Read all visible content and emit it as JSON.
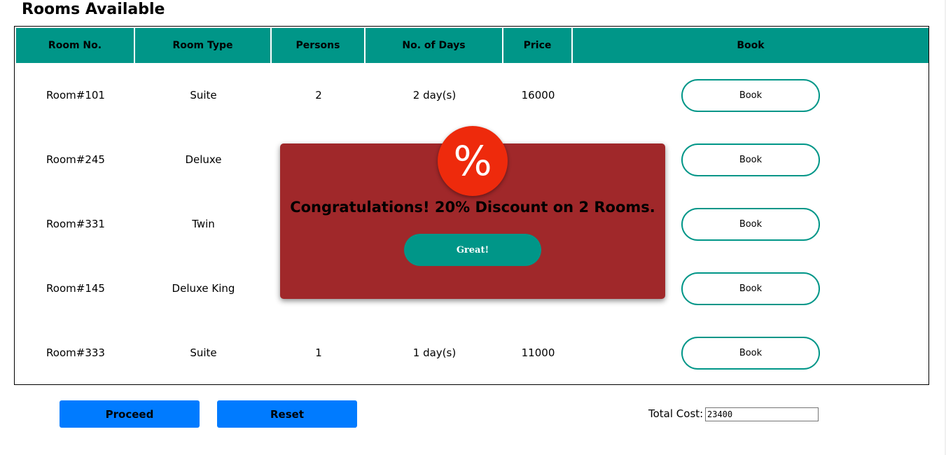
{
  "page": {
    "title": "Rooms Available"
  },
  "table": {
    "headers": [
      "Room No.",
      "Room Type",
      "Persons",
      "No. of Days",
      "Price",
      "Book"
    ],
    "rows": [
      {
        "room_no": "Room#101",
        "room_type": "Suite",
        "persons": "2",
        "days": "2 day(s)",
        "price": "16000",
        "book_label": "Book"
      },
      {
        "room_no": "Room#245",
        "room_type": "Deluxe",
        "persons": "",
        "days": "",
        "price": "",
        "book_label": "Book"
      },
      {
        "room_no": "Room#331",
        "room_type": "Twin",
        "persons": "",
        "days": "",
        "price": "",
        "book_label": "Book"
      },
      {
        "room_no": "Room#145",
        "room_type": "Deluxe King",
        "persons": "",
        "days": "",
        "price": "",
        "book_label": "Book"
      },
      {
        "room_no": "Room#333",
        "room_type": "Suite",
        "persons": "1",
        "days": "1 day(s)",
        "price": "11000",
        "book_label": "Book"
      }
    ]
  },
  "modal": {
    "icon": "percent-icon",
    "icon_glyph": "%",
    "message": "Congratulations! 20% Discount on 2 Rooms.",
    "button_label": "Great!"
  },
  "actions": {
    "proceed_label": "Proceed",
    "reset_label": "Reset"
  },
  "total": {
    "label": "Total Cost:",
    "value": "23400"
  },
  "colors": {
    "header_bg": "#009688",
    "modal_bg": "#a0282a",
    "badge_bg": "#ee2a0c",
    "primary_button": "#007bff"
  }
}
